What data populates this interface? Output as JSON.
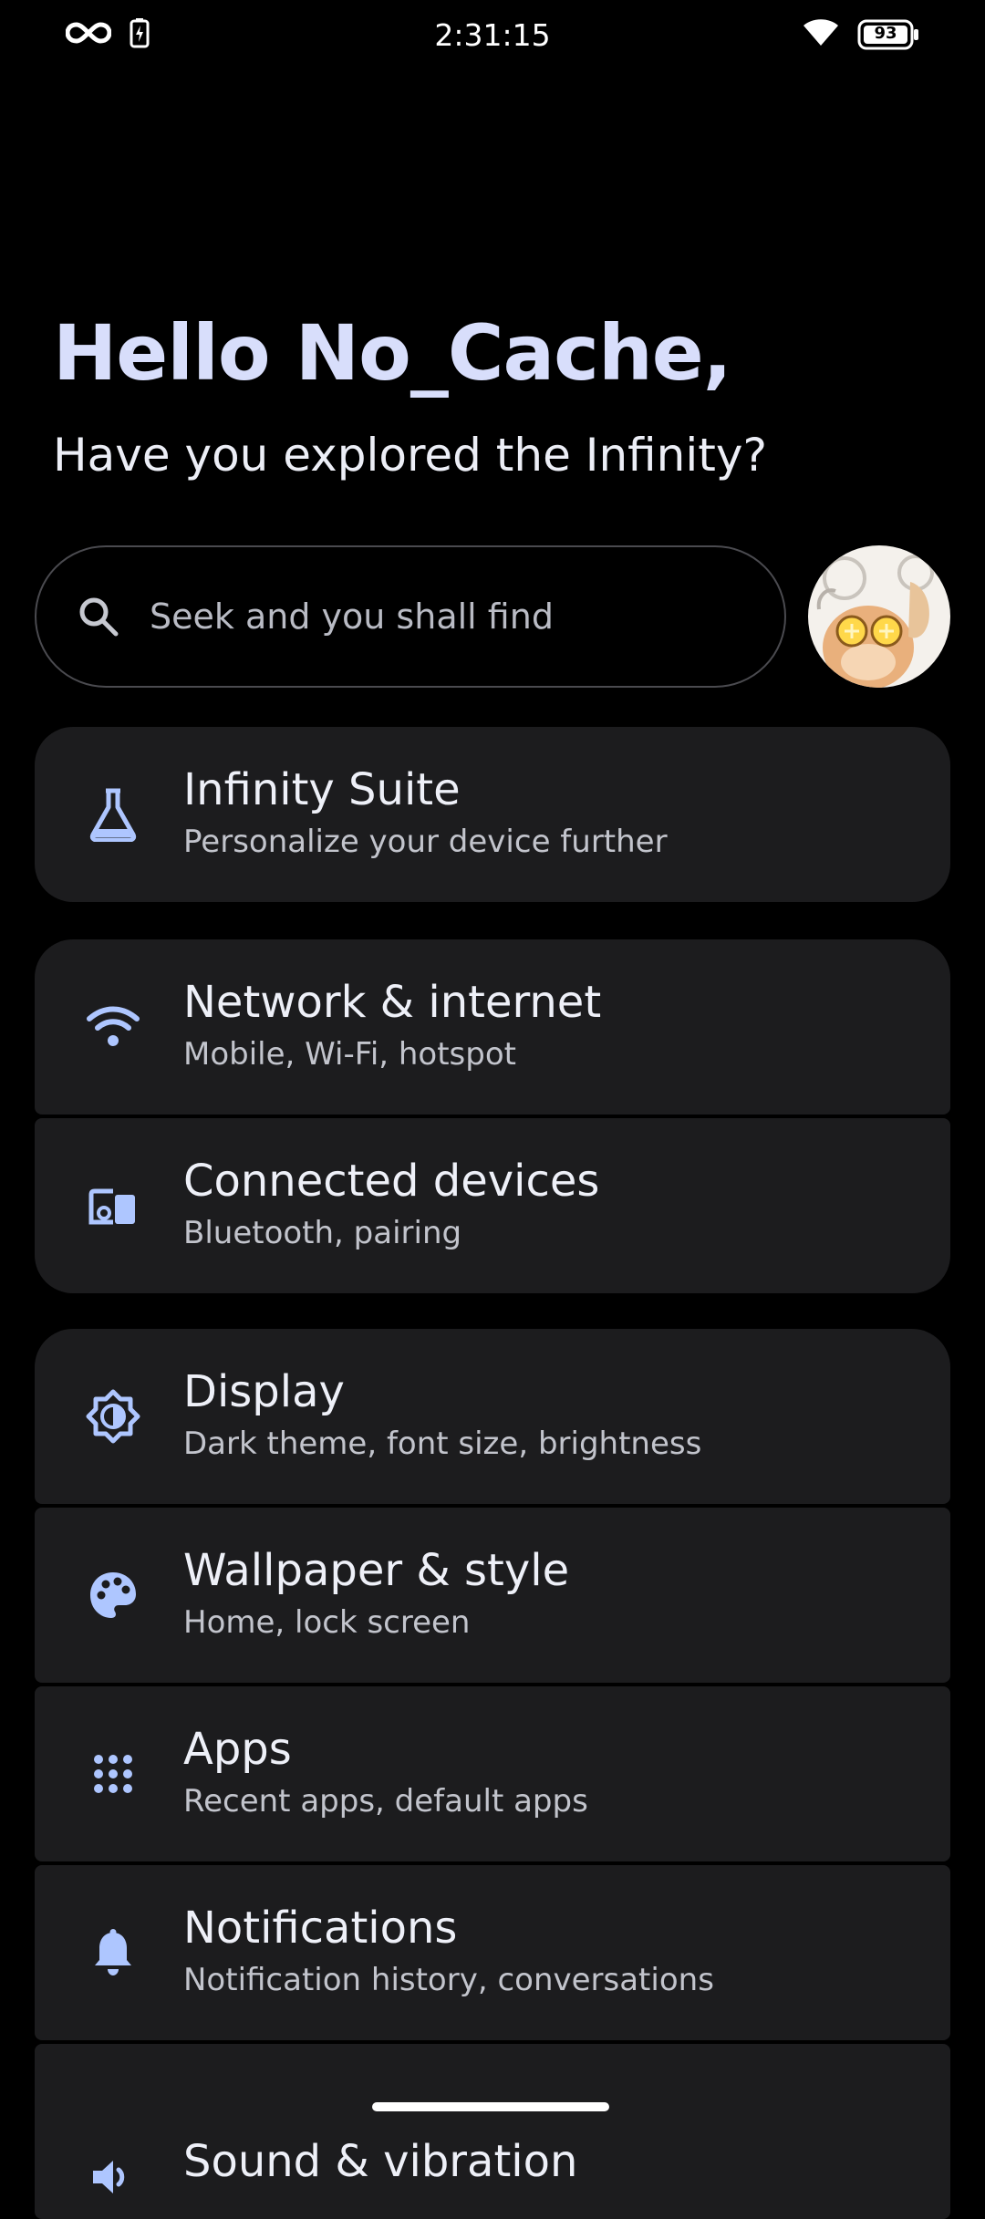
{
  "status_bar": {
    "time": "2:31:15",
    "battery_level": "93",
    "icons": [
      "infinity-icon",
      "battery-saver-icon",
      "wifi-icon",
      "battery-icon"
    ]
  },
  "header": {
    "greeting": "Hello No_Cache,",
    "subtitle": "Have you explored the Infinity?"
  },
  "search": {
    "placeholder": "Seek and you shall find"
  },
  "colors": {
    "accent": "#aec6ff",
    "card": "#1c1c1e",
    "background": "#000000",
    "greeting": "#d8defb"
  },
  "groups": [
    {
      "items": [
        {
          "icon": "flask-icon",
          "title": "Infinity Suite",
          "subtitle": "Personalize your device further"
        }
      ]
    },
    {
      "items": [
        {
          "icon": "wifi-icon",
          "title": "Network & internet",
          "subtitle": "Mobile, Wi-Fi, hotspot"
        },
        {
          "icon": "devices-icon",
          "title": "Connected devices",
          "subtitle": "Bluetooth, pairing"
        }
      ]
    },
    {
      "items": [
        {
          "icon": "brightness-icon",
          "title": "Display",
          "subtitle": "Dark theme, font size, brightness"
        },
        {
          "icon": "palette-icon",
          "title": "Wallpaper & style",
          "subtitle": "Home, lock screen"
        },
        {
          "icon": "apps-grid-icon",
          "title": "Apps",
          "subtitle": "Recent apps, default apps"
        },
        {
          "icon": "bell-icon",
          "title": "Notifications",
          "subtitle": "Notification history, conversations"
        },
        {
          "icon": "speaker-icon",
          "title": "Sound & vibration",
          "subtitle": ""
        }
      ]
    }
  ]
}
